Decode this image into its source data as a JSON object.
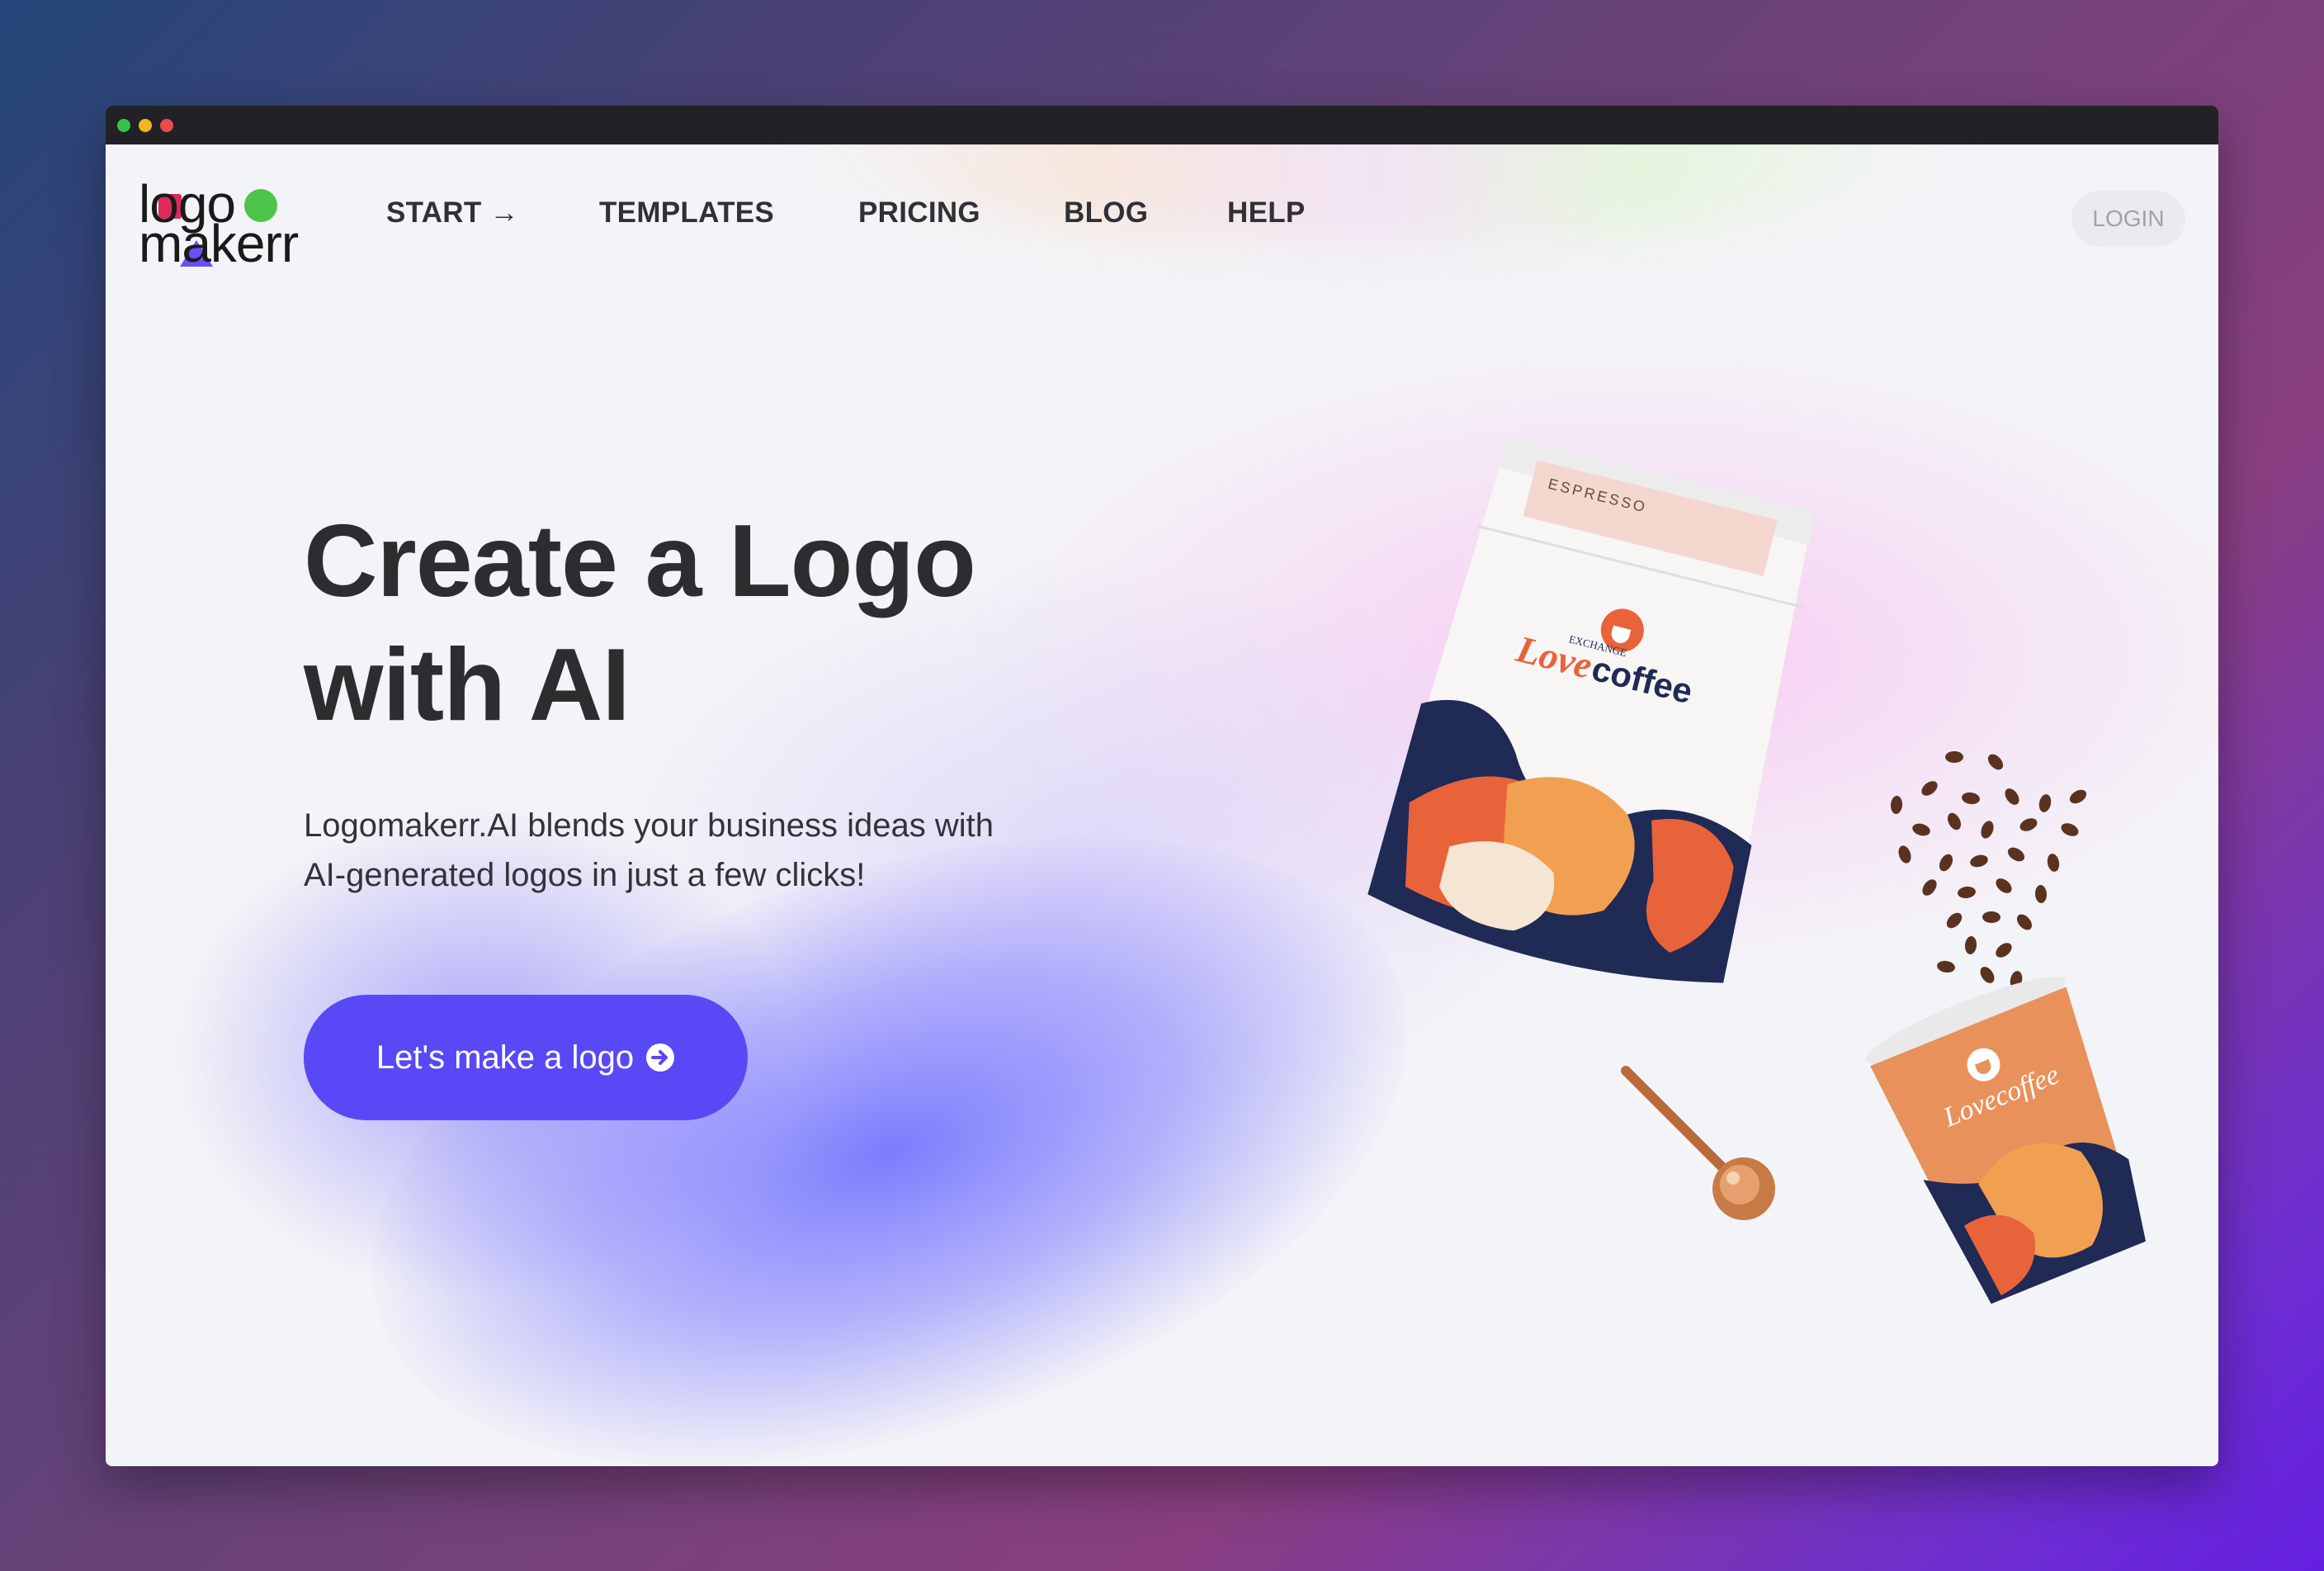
{
  "nav": {
    "logo_line1": "logo",
    "logo_line2": "makerr",
    "items": [
      {
        "label": "START →"
      },
      {
        "label": "TEMPLATES"
      },
      {
        "label": "PRICING"
      },
      {
        "label": "BLOG"
      },
      {
        "label": "HELP"
      }
    ],
    "login_label": "LOGIN"
  },
  "hero": {
    "title_line1": "Create a Logo",
    "title_line2": "with AI",
    "subtitle_line1": "Logomakerr.AI blends your business ideas with",
    "subtitle_line2": "AI-generated logos in just a few clicks!",
    "cta_label": "Let's make a logo"
  },
  "illustration": {
    "bag_label": "ESPRESSO",
    "bag_brand_small": "EXCHANGE",
    "bag_brand_love": "Love",
    "bag_brand_coffee": "coffee",
    "cup_brand": "Lovecoffee"
  },
  "colors": {
    "accent": "#5948f6",
    "logo_red": "#de2a59",
    "logo_green": "#4cc54a",
    "logo_purple": "#6a4ef7",
    "brand_orange": "#e8633a",
    "brand_navy": "#1f2a55"
  },
  "icons": {
    "cta_icon": "arrow-circle-right-icon",
    "start_icon": "arrow-right-icon"
  }
}
